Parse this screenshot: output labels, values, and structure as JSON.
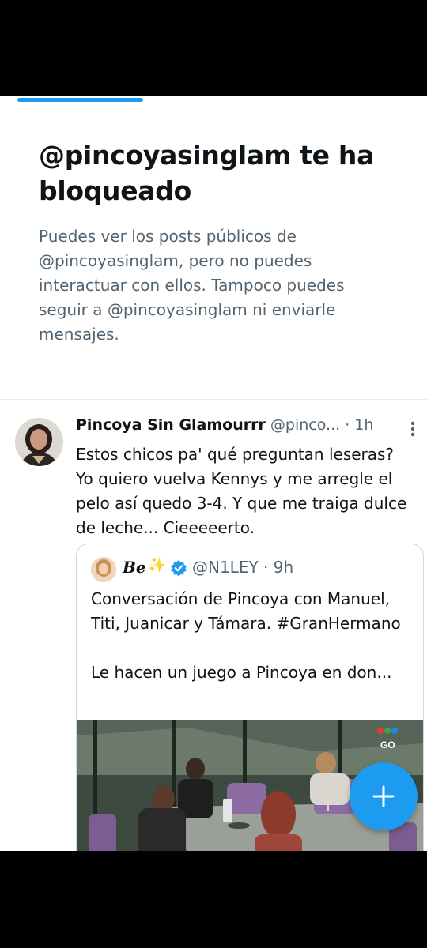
{
  "blocked": {
    "title": "@pincoyasinglam te ha bloqueado",
    "description": "Puedes ver los posts públicos de @pincoyasinglam, pero no puedes interactuar con ellos. Tampoco puedes seguir a @pincoyasinglam ni enviarle mensajes."
  },
  "tweet": {
    "name": "Pincoya Sin Glamourrr",
    "handle": "@pinco...",
    "time": "· 1h",
    "text": "Estos chicos pa' qué preguntan leseras? Yo quiero vuelva Kennys y me arregle el pelo así quedo 3-4. Y que me traiga dulce de leche... Cieeeeerto.",
    "quote": {
      "name": "Be",
      "sparkle": "✨",
      "handle": "@N1LEY · 9h",
      "text_line1": "Conversación de Pincoya con Manuel, Titi, Juanicar y Támara. #GranHermano",
      "text_line2": "Le hacen un juego a Pincoya en don...",
      "media_watermark": "GO"
    }
  },
  "icons": {
    "more": "more-vertical-icon",
    "verified": "verified-badge-icon",
    "compose": "plus-icon"
  },
  "colors": {
    "accent": "#1d9bf0",
    "text_primary": "#0f1419",
    "text_secondary": "#536471"
  }
}
